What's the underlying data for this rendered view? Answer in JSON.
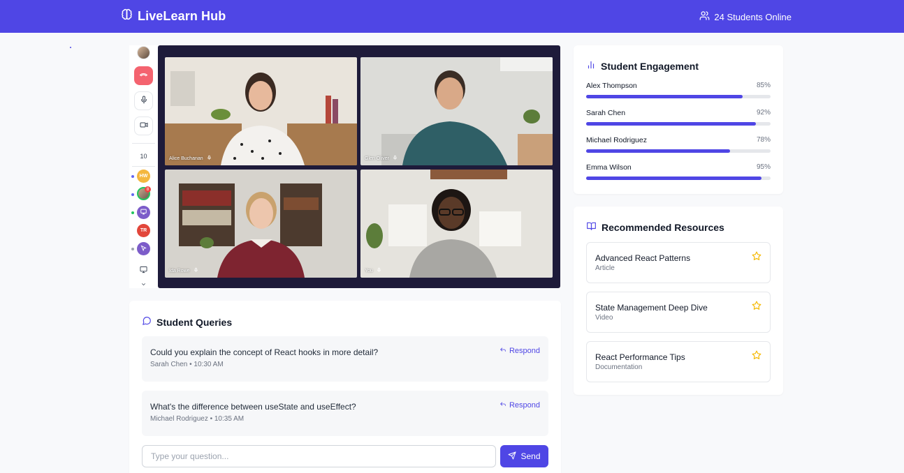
{
  "header": {
    "brand": "LiveLearn Hub",
    "online_text": "24 Students Online"
  },
  "rail": {
    "count": "10",
    "badge": "8",
    "participants": [
      {
        "initials": "HW",
        "color": "#f4b73f",
        "status": "#6366f1"
      },
      {
        "initials": "",
        "color": "#22c55e",
        "status": "#6366f1"
      },
      {
        "initials": "",
        "color": "#7c5cc9",
        "status": "#22c55e"
      },
      {
        "initials": "TR",
        "color": "#e2463a",
        "status": ""
      },
      {
        "initials": "",
        "color": "#7c5cc9",
        "status": "#9ca3af"
      }
    ]
  },
  "video": {
    "tiles": [
      {
        "name": "Alice Buchanan"
      },
      {
        "name": "Glen Oliver"
      },
      {
        "name": "Ida Rowe"
      },
      {
        "name": "You"
      }
    ]
  },
  "queries": {
    "title": "Student Queries",
    "items": [
      {
        "text": "Could you explain the concept of React hooks in more detail?",
        "meta": "Sarah Chen • 10:30 AM",
        "action": "Respond"
      },
      {
        "text": "What's the difference between useState and useEffect?",
        "meta": "Michael Rodriguez • 10:35 AM",
        "action": "Respond"
      }
    ],
    "input_placeholder": "Type your question...",
    "send_label": "Send"
  },
  "engagement": {
    "title": "Student Engagement",
    "students": [
      {
        "name": "Alex Thompson",
        "pct_label": "85%",
        "value": 85
      },
      {
        "name": "Sarah Chen",
        "pct_label": "92%",
        "value": 92
      },
      {
        "name": "Michael Rodriguez",
        "pct_label": "78%",
        "value": 78
      },
      {
        "name": "Emma Wilson",
        "pct_label": "95%",
        "value": 95
      }
    ]
  },
  "resources": {
    "title": "Recommended Resources",
    "items": [
      {
        "title": "Advanced React Patterns",
        "type": "Article"
      },
      {
        "title": "State Management Deep Dive",
        "type": "Video"
      },
      {
        "title": "React Performance Tips",
        "type": "Documentation"
      }
    ]
  },
  "colors": {
    "primary": "#4f46e5",
    "danger": "#f4636f",
    "star": "#f5b800"
  }
}
